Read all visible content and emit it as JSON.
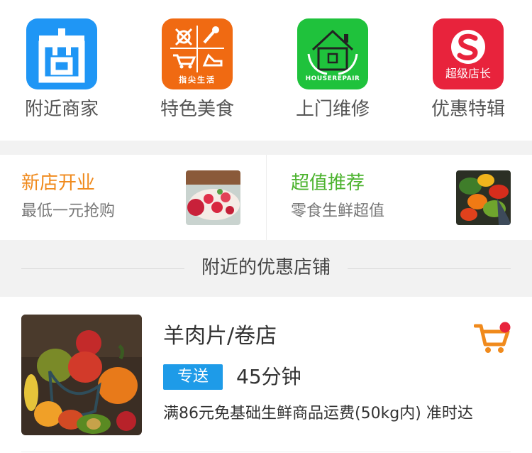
{
  "nav": {
    "items": [
      {
        "label": "附近商家",
        "icon": "shop-icon",
        "color": "#1f96f5"
      },
      {
        "label": "特色美食",
        "icon": "food-icon",
        "color": "#f06a12",
        "logo_text": "指尖生活"
      },
      {
        "label": "上门维修",
        "icon": "house-repair-icon",
        "color": "#1fc23c",
        "logo_text": "HOUSEREPAIR"
      },
      {
        "label": "优惠特辑",
        "icon": "super-manager-icon",
        "color": "#e8233c",
        "logo_text": "超级店长"
      }
    ]
  },
  "promos": [
    {
      "title": "新店开业",
      "subtitle": "最低一元抢购",
      "title_color": "#f08a1c"
    },
    {
      "title": "超值推荐",
      "subtitle": "零食生鲜超值",
      "title_color": "#4cb32e"
    }
  ],
  "section": {
    "title": "附近的优惠店铺"
  },
  "shop": {
    "name": "羊肉片/卷店",
    "badge": "专送",
    "eta": "45分钟",
    "promo": "满86元免基础生鲜商品运费(50kg内) 准时达",
    "badge_color": "#1e9be8",
    "cart_color": "#f08a1c",
    "cart_dot_color": "#e8233c"
  }
}
